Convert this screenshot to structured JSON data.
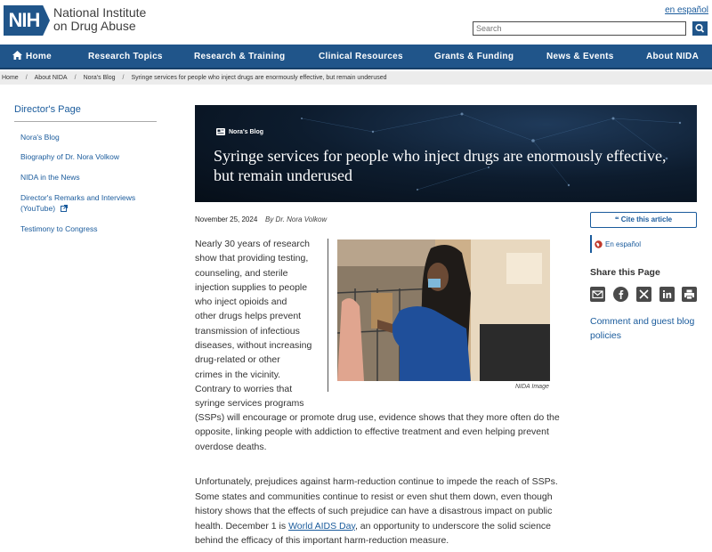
{
  "header": {
    "logo_text": "NIH",
    "org_line1": "National Institute",
    "org_line2": "on Drug Abuse",
    "lang_link": "en español",
    "search_placeholder": "Search"
  },
  "nav": {
    "items": [
      "Home",
      "Research Topics",
      "Research & Training",
      "Clinical Resources",
      "Grants & Funding",
      "News & Events",
      "About NIDA"
    ]
  },
  "breadcrumb": [
    "Home",
    "About NIDA",
    "Nora's Blog",
    "Syringe services for people who inject drugs are enormously effective, but remain underused"
  ],
  "sidebar": {
    "title": "Director's Page",
    "links": [
      "Nora's Blog",
      "Biography of Dr. Nora Volkow",
      "NIDA in the News",
      "Director's Remarks and Interviews",
      "(YouTube)",
      "Testimony to Congress"
    ]
  },
  "hero": {
    "badge": "Nora's Blog",
    "title": "Syringe services for people who inject drugs are enormously effective, but remain underused"
  },
  "article": {
    "date": "November 25, 2024",
    "author": "By Dr. Nora Volkow",
    "p1_lines": [
      "Nearly 30 years of research",
      "show that providing testing,",
      "counseling, and sterile",
      "injection supplies to people",
      "who inject opioids and",
      "other drugs helps prevent",
      "transmission of infectious",
      "diseases, without increasing",
      "drug-related or other",
      "crimes in the vicinity.",
      "Contrary to worries that",
      "syringe services programs"
    ],
    "p1_tail": "(SSPs) will encourage or promote drug use, evidence shows that they more often do the opposite, linking people with addiction to effective treatment and even helping prevent overdose deaths.",
    "p2_before": "Unfortunately, prejudices against harm-reduction continue to impede the reach of SSPs. Some states and communities continue to resist or even shut them down, even though history shows that the effects of such prejudice can have a disastrous impact on public health. December 1 is ",
    "p2_link": "World AIDS Day",
    "p2_after": ", an opportunity to underscore the solid science behind the efficacy of this important harm-reduction measure.",
    "image_caption": "NIDA Image"
  },
  "rail": {
    "cite_label": "Cite this article",
    "es_label": "En español",
    "share_title": "Share this Page",
    "share_icons": [
      "email-icon",
      "facebook-icon",
      "x-icon",
      "linkedin-icon",
      "print-icon"
    ],
    "comment_link": "Comment and guest blog policies"
  },
  "colors": {
    "brand": "#20558a",
    "link": "#1a5b9c"
  }
}
